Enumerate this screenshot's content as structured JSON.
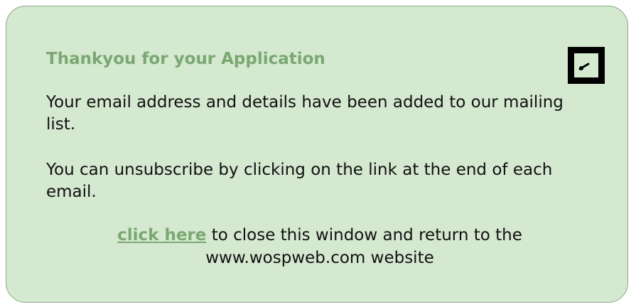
{
  "dialog": {
    "title": "Thankyou for your Application",
    "close_icon": "pencil-icon",
    "paragraph_1": "Your email address and details have been added to our mailing list.",
    "paragraph_2": "You can unsubscribe by clicking on the link at the end of each email.",
    "footer": {
      "link_label": "click here",
      "text_line_1": " to close this window and return to the",
      "text_line_2": "www.wospweb.com website"
    }
  },
  "colors": {
    "panel_background": "#d5e8d0",
    "panel_border": "#8ea88a",
    "accent_green": "#7aa872",
    "text": "#111111"
  }
}
